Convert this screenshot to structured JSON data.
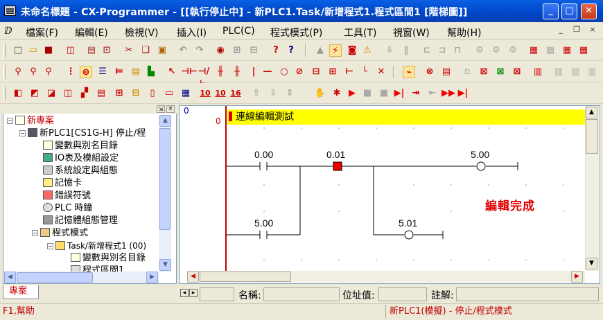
{
  "window": {
    "title": "未命名標題 - CX-Programmer - [[執行停止中] - 新PLC1.Task/新增程式1.程式區間1 [階梯圖]]",
    "minimize": "_",
    "maximize": "□",
    "close": "✕"
  },
  "menu": {
    "items": [
      "檔案(F)",
      "編輯(E)",
      "檢視(V)",
      "插入(I)",
      "PLC(C)",
      "程式模式(P)",
      "工具(T)",
      "視窗(W)",
      "幫助(H)"
    ],
    "mdi_min": "_",
    "mdi_restore": "❐",
    "mdi_close": "×"
  },
  "toolbar": {
    "row1": [
      "new",
      "open",
      "save",
      "preview",
      "print",
      "print-preview",
      "cut",
      "copy",
      "paste",
      "undo",
      "redo",
      "find",
      "find-replace",
      "replace",
      "help",
      "help-context",
      "up",
      "online",
      "monitor",
      "warning"
    ],
    "row3_labels": {
      "b10": "10",
      "b10p": "10",
      "b16": "16"
    }
  },
  "tree": {
    "root": "新專案",
    "plc": "新PLC1[CS1G-H] 停止/程",
    "items": [
      "變數與別名目錄",
      "IO表及模組設定",
      "系統設定與組態",
      "記憶卡",
      "錯誤符號",
      "PLC 時鐘",
      "記憶體組態管理",
      "程式模式",
      "Task/新增程式1 (00)",
      "變數與別名目錄",
      "程式區間1"
    ],
    "tab": "專案"
  },
  "editor": {
    "rung_number": "0",
    "step_number": "0",
    "comment": "連線編輯測試",
    "contacts": [
      {
        "addr": "0.00"
      },
      {
        "addr": "0.01"
      },
      {
        "addr": "5.00"
      }
    ],
    "coils": [
      {
        "addr": "5.00"
      },
      {
        "addr": "5.01"
      }
    ],
    "annotation": "編輯完成",
    "annotation_color": "#e00000"
  },
  "statusfields": {
    "name_label": "名稱:",
    "address_label": "位址值:",
    "comment_label": "註解:"
  },
  "statusbar": {
    "help": "F1,幫助",
    "mode": "新PLC1(模擬) - 停止/程式模式"
  }
}
